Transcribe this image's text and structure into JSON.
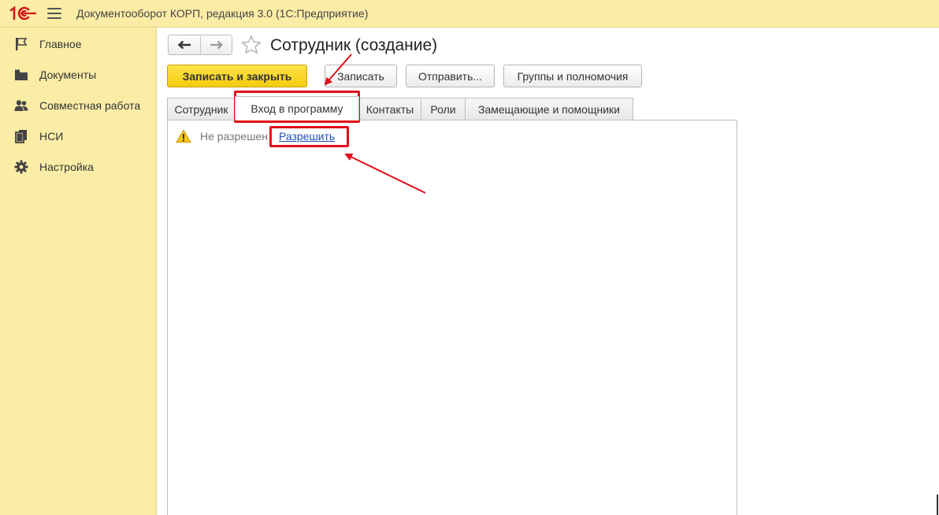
{
  "app": {
    "title": "Документооборот КОРП, редакция 3.0  (1С:Предприятие)",
    "logo_icon": "1c-logo-icon",
    "menu_icon": "hamburger-menu-icon"
  },
  "sidebar": {
    "items": [
      {
        "label": "Главное",
        "icon": "flag-icon"
      },
      {
        "label": "Документы",
        "icon": "folder-icon"
      },
      {
        "label": "Совместная работа",
        "icon": "users-icon"
      },
      {
        "label": "НСИ",
        "icon": "copy-icon"
      },
      {
        "label": "Настройка",
        "icon": "gear-icon"
      }
    ]
  },
  "form": {
    "title": "Сотрудник (создание)",
    "back_icon": "arrow-left-icon",
    "forward_icon": "arrow-right-icon",
    "favorite_icon": "star-outline-icon"
  },
  "toolbar": {
    "save_close_label": "Записать и закрыть",
    "save_label": "Записать",
    "send_label": "Отправить...",
    "groups_label": "Группы и полномочия"
  },
  "tabs": [
    {
      "label": "Сотрудник",
      "active": false
    },
    {
      "label": "Вход в программу",
      "active": true
    },
    {
      "label": "Контакты",
      "active": false
    },
    {
      "label": "Роли",
      "active": false
    },
    {
      "label": "Замещающие и помощники",
      "active": false
    }
  ],
  "login_tab": {
    "status_text": "Не разрешен",
    "allow_link": "Разрешить",
    "warning_icon": "warning-triangle-icon"
  },
  "colors": {
    "chrome_yellow": "#fbeda6",
    "primary_button": "#f3cc0c",
    "annotation_red": "#e0101a",
    "link_blue": "#1f4fb4"
  }
}
